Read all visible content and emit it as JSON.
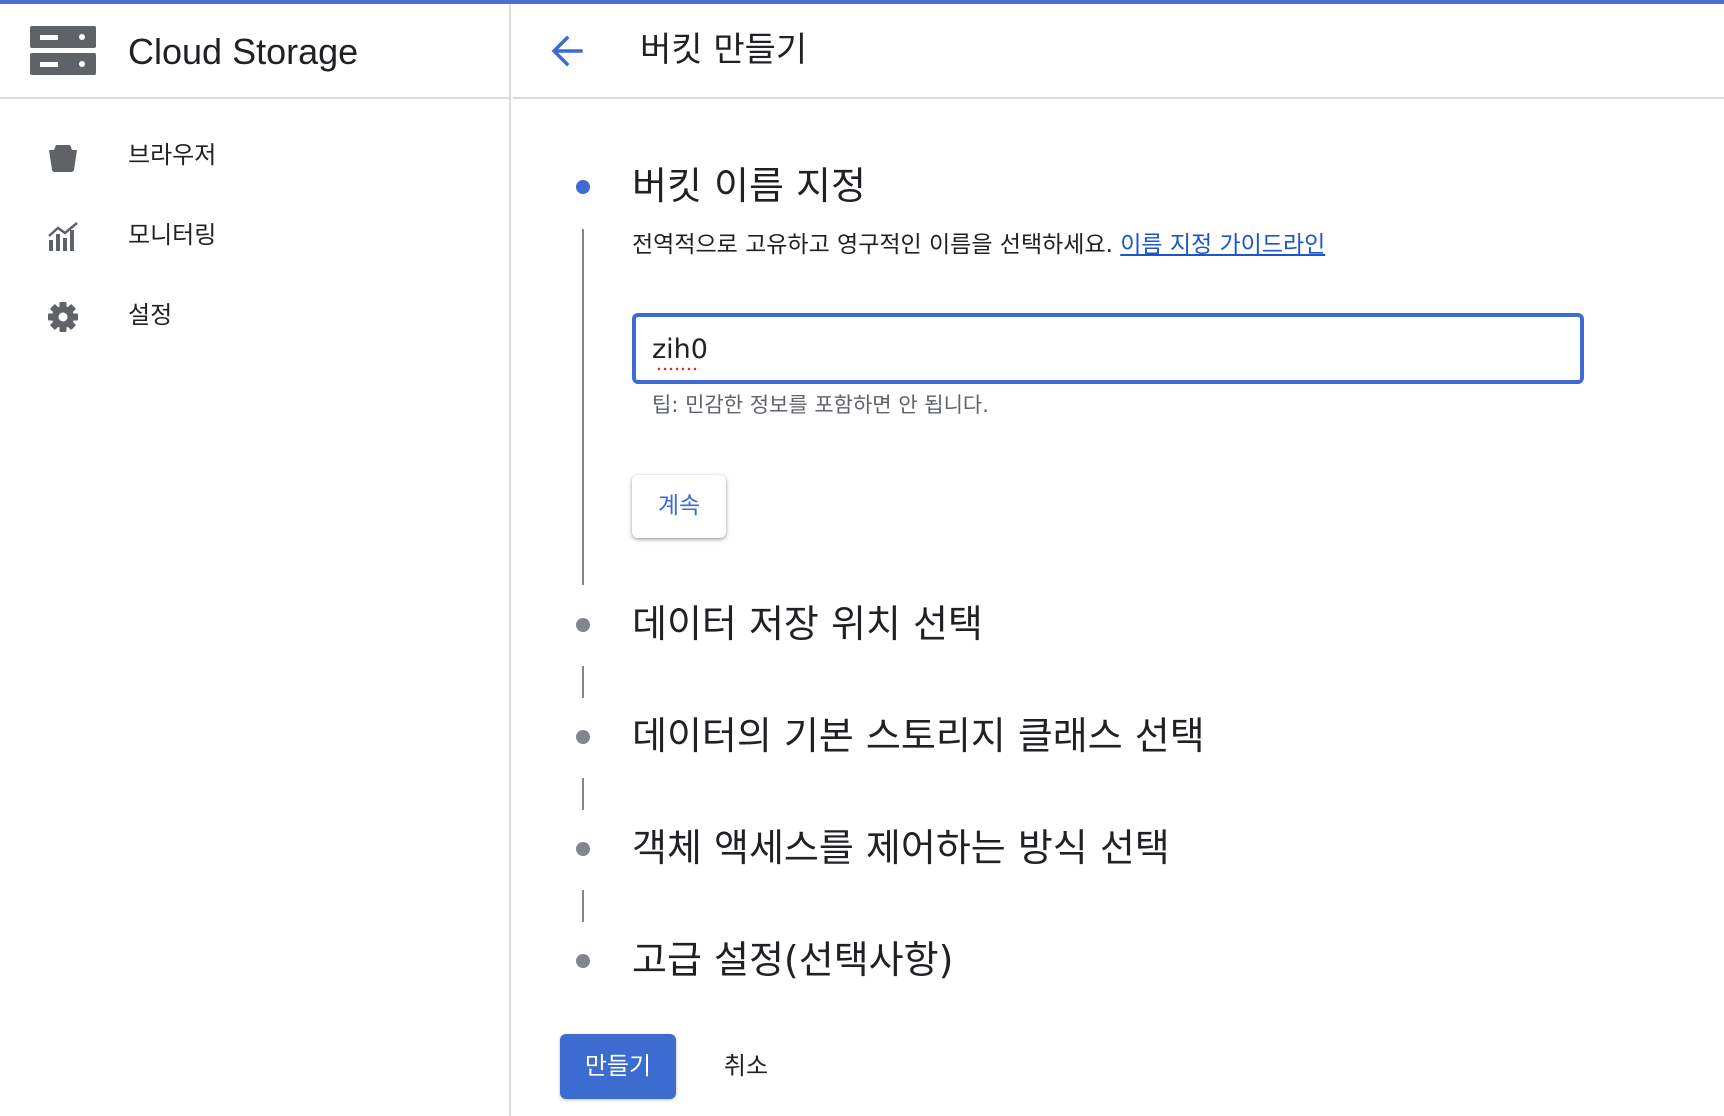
{
  "colors": {
    "accent": "#3c6ccf",
    "link": "#1a56c8",
    "inactive_dot": "#80868b",
    "top_bar": "#4a6fd0"
  },
  "sidebar": {
    "product_icon": "storage-server-icon",
    "product_title": "Cloud Storage",
    "items": [
      {
        "icon": "bucket-icon",
        "label": "브라우저"
      },
      {
        "icon": "monitoring-chart-icon",
        "label": "모니터링"
      },
      {
        "icon": "gear-icon",
        "label": "설정"
      }
    ]
  },
  "header": {
    "back_icon": "arrow-back-icon",
    "title": "버킷 만들기"
  },
  "steps": [
    {
      "title": "버킷 이름 지정",
      "active": true,
      "description": "전역적으로 고유하고 영구적인 이름을 선택하세요.",
      "guide_link": "이름 지정 가이드라인",
      "input_value": "zih0",
      "hint": "팁: 민감한 정보를 포함하면 안 됩니다.",
      "continue_label": "계속"
    },
    {
      "title": "데이터 저장 위치 선택",
      "active": false
    },
    {
      "title": "데이터의 기본 스토리지 클래스 선택",
      "active": false
    },
    {
      "title": "객체 액세스를 제어하는 방식 선택",
      "active": false
    },
    {
      "title": "고급 설정(선택사항)",
      "active": false
    }
  ],
  "actions": {
    "create_label": "만들기",
    "cancel_label": "취소"
  }
}
